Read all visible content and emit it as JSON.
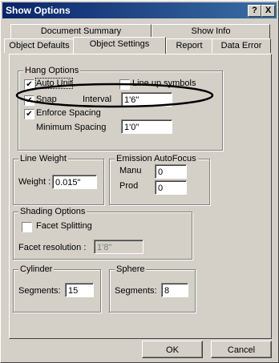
{
  "title": "Show Options",
  "title_buttons": {
    "help": "?",
    "close": "X"
  },
  "tabs_back": [
    "Document Summary",
    "Show Info"
  ],
  "tabs_front": [
    "Object Defaults",
    "Object Settings",
    "Report",
    "Data Error"
  ],
  "active_tab": "Object Settings",
  "hang": {
    "legend": "Hang Options",
    "auto_unit": {
      "label": "Auto Unit",
      "checked": true
    },
    "line_up": {
      "label": "Line up symbols",
      "checked": false
    },
    "snap": {
      "label": "Snap",
      "checked": true
    },
    "interval_label": "Interval",
    "interval_value": "1'6\"",
    "enforce": {
      "label": "Enforce Spacing",
      "checked": true
    },
    "min_spacing_label": "Minimum Spacing",
    "min_spacing_value": "1'0\""
  },
  "line_weight": {
    "legend": "Line Weight",
    "label": "Weight :",
    "value": "0.015\""
  },
  "emission": {
    "legend": "Emission AutoFocus",
    "manu_label": "Manu",
    "manu_value": "0",
    "prod_label": "Prod",
    "prod_value": "0"
  },
  "shading": {
    "legend": "Shading Options",
    "facet_split_label": "Facet Splitting",
    "facet_split_checked": false,
    "facet_res_label": "Facet resolution :",
    "facet_res_value": "1'8\""
  },
  "cylinder": {
    "legend": "Cylinder",
    "label": "Segments:",
    "value": "15"
  },
  "sphere": {
    "legend": "Sphere",
    "label": "Segments:",
    "value": "8"
  },
  "buttons": {
    "ok": "OK",
    "cancel": "Cancel"
  },
  "check_glyph": "✔"
}
